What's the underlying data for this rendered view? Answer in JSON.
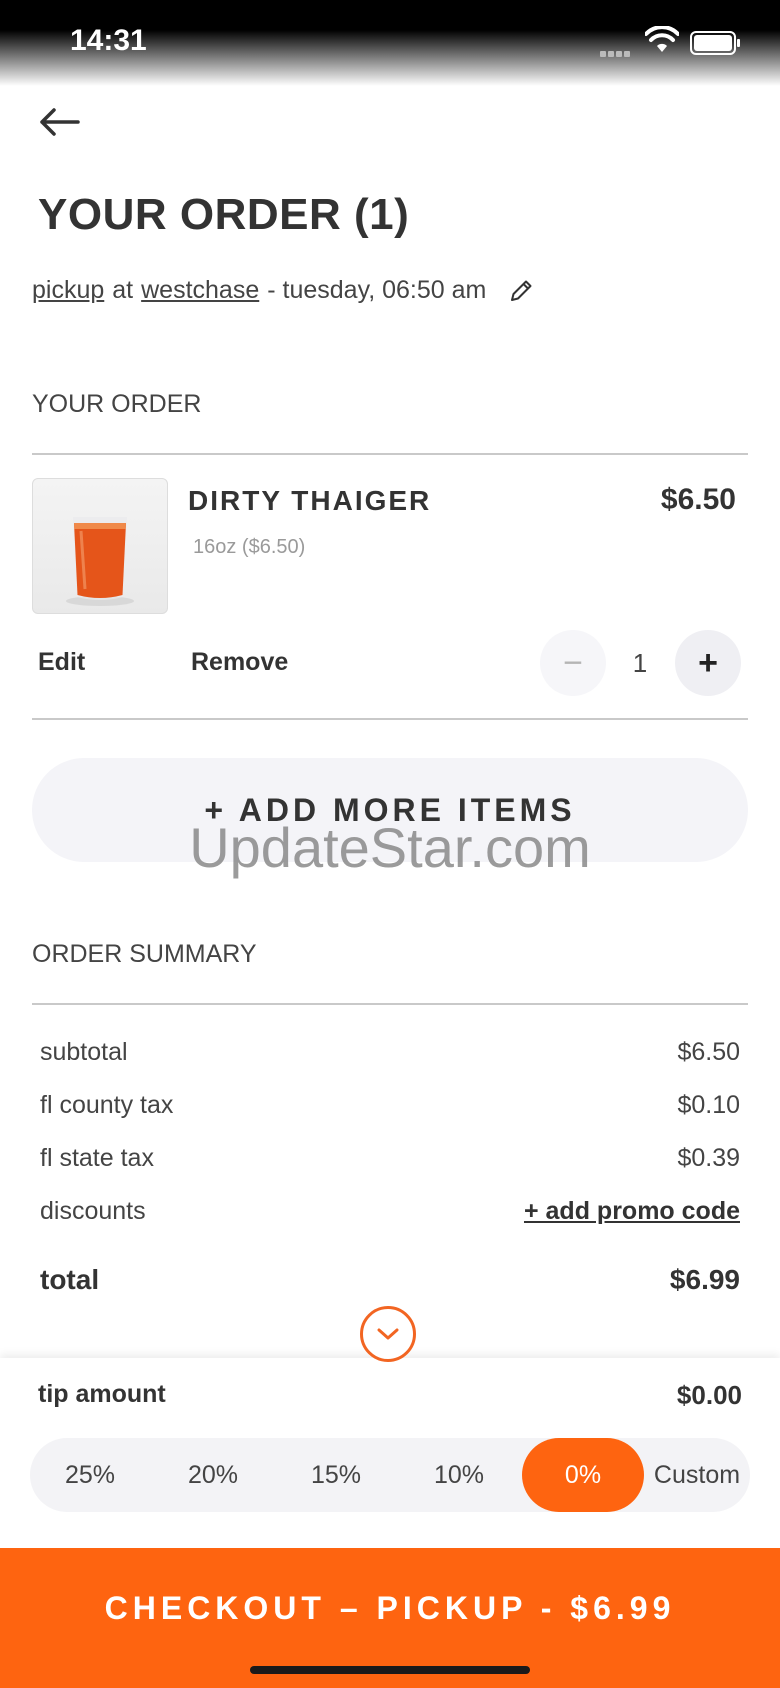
{
  "status_bar": {
    "time": "14:31"
  },
  "header": {
    "title": "YOUR ORDER (1)",
    "mode": "pickup",
    "at_text": "at",
    "location": "westchase",
    "datetime": "- tuesday, 06:50 am"
  },
  "order": {
    "section_title": "YOUR ORDER",
    "item": {
      "name": "DIRTY THAIGER",
      "price": "$6.50",
      "option": "16oz ($6.50)",
      "quantity": "1",
      "edit_label": "Edit",
      "remove_label": "Remove",
      "minus_label": "−",
      "plus_label": "+"
    },
    "add_more_label": "+ ADD MORE ITEMS"
  },
  "watermark": "UpdateStar.com",
  "summary": {
    "section_title": "ORDER SUMMARY",
    "rows": [
      {
        "label": "subtotal",
        "value": "$6.50"
      },
      {
        "label": "fl county tax",
        "value": "$0.10"
      },
      {
        "label": "fl state tax",
        "value": "$0.39"
      },
      {
        "label": "discounts",
        "value": "+ add promo code"
      }
    ],
    "total": {
      "label": "total",
      "value": "$6.99"
    }
  },
  "tip": {
    "label": "tip amount",
    "amount": "$0.00",
    "options": [
      "25%",
      "20%",
      "15%",
      "10%",
      "0%",
      "Custom"
    ],
    "selected": "0%"
  },
  "checkout": {
    "label": "CHECKOUT – PICKUP - $6.99"
  },
  "colors": {
    "accent": "#fe6410",
    "text": "#333333",
    "pill_bg": "#f3f3f6"
  },
  "icons": {
    "back": "arrow-left-icon",
    "edit_order": "pencil-icon",
    "expand": "chevron-down-icon",
    "wifi": "wifi-icon",
    "battery": "battery-icon",
    "signal": "signal-icon"
  }
}
